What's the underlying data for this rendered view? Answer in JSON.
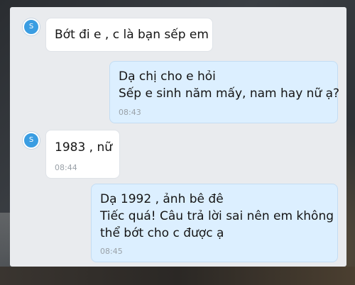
{
  "conversation": {
    "contact_avatar_letter": "S",
    "messages": [
      {
        "direction": "incoming",
        "lines": [
          "Bớt đi e , c là bạn sếp em"
        ],
        "time": ""
      },
      {
        "direction": "outgoing",
        "lines": [
          "Dạ chị cho e hỏi",
          "Sếp e sinh năm mấy, nam hay nữ ạ?"
        ],
        "time": "08:43"
      },
      {
        "direction": "incoming",
        "lines": [
          "1983 , nữ"
        ],
        "time": "08:44"
      },
      {
        "direction": "outgoing",
        "lines": [
          "Dạ 1992 , ảnh bê đê",
          "Tiếc quá! Câu trả lời sai nên em không",
          "thể bớt cho c được ạ"
        ],
        "time": "08:45"
      }
    ]
  },
  "colors": {
    "incoming_bubble": "#ffffff",
    "outgoing_bubble": "#dcefff",
    "avatar": "#3a9de2",
    "chat_background": "#e9ebee",
    "timestamp": "#9aa1a8"
  }
}
